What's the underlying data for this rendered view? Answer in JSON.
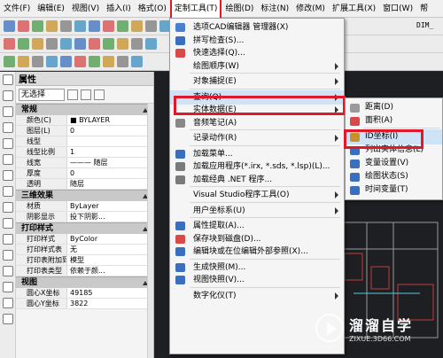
{
  "menubar": [
    "文件(F)",
    "编辑(E)",
    "视图(V)",
    "插入(I)",
    "格式(O)",
    "定制工具(T)",
    "绘图(D)",
    "标注(N)",
    "修改(M)",
    "扩展工具(X)",
    "窗口(W)",
    "帮"
  ],
  "toolbar_right_text": "DIM_",
  "panel": {
    "title": "属性",
    "selection": "无选择",
    "groups": [
      {
        "name": "常规",
        "rows": [
          {
            "k": "颜色(C)",
            "v": "■ BYLAYER"
          },
          {
            "k": "图层(L)",
            "v": "0"
          },
          {
            "k": "线型",
            "v": ""
          },
          {
            "k": "线型比例",
            "v": "1"
          },
          {
            "k": "线宽",
            "v": "——— 随层"
          },
          {
            "k": "厚度",
            "v": "0"
          },
          {
            "k": "透明",
            "v": "随层"
          }
        ]
      },
      {
        "name": "三维效果",
        "rows": [
          {
            "k": "材质",
            "v": "ByLayer"
          },
          {
            "k": "阴影显示",
            "v": "投下阴影..."
          }
        ]
      },
      {
        "name": "打印样式",
        "rows": [
          {
            "k": "打印样式",
            "v": "ByColor"
          },
          {
            "k": "打印样式表",
            "v": "无"
          },
          {
            "k": "打印表附加到",
            "v": "模型"
          },
          {
            "k": "打印表类型",
            "v": "依赖于颜..."
          }
        ]
      },
      {
        "name": "视图",
        "rows": [
          {
            "k": "圆心X坐标",
            "v": "49185"
          },
          {
            "k": "圆心Y坐标",
            "v": "3822"
          }
        ]
      }
    ]
  },
  "menu": [
    {
      "label": "选项CAD编辑器 管理器(X)",
      "icon": "#4a7fcf"
    },
    {
      "label": "拼写检查(S)...",
      "icon": "#3a6fbf"
    },
    {
      "label": "快速选择(Q)...",
      "icon": "#d84a4a"
    },
    {
      "label": "绘图顺序(W)",
      "arrow": true
    },
    {
      "sep": true
    },
    {
      "label": "对象捕捉(E)",
      "arrow": true
    },
    {
      "sep": true
    },
    {
      "label": "查询(Q)",
      "arrow": true,
      "hl": true
    },
    {
      "label": "实体数据(E)",
      "arrow": true
    },
    {
      "label": "音频笔记(A)",
      "icon": "#888888"
    },
    {
      "sep": true
    },
    {
      "label": "记录动作(R)",
      "arrow": true
    },
    {
      "sep": true
    },
    {
      "label": "加载菜单...",
      "icon": "#3a6fbf"
    },
    {
      "label": "加载应用程序(*.irx, *.sds, *.lsp)(L)...",
      "icon": "#7a7a7a"
    },
    {
      "label": "加载经典 .NET 程序...",
      "icon": "#7a7a7a"
    },
    {
      "sep": true
    },
    {
      "label": "Visual Studio程序工具(O)",
      "arrow": true
    },
    {
      "sep": true
    },
    {
      "label": "用户坐标系(U)",
      "arrow": true
    },
    {
      "sep": true
    },
    {
      "label": "属性提取(A)...",
      "icon": "#3a6fbf"
    },
    {
      "label": "保存块到磁盘(D)...",
      "icon": "#d84a4a"
    },
    {
      "label": "编辑块或在位编辑外部参照(X)...",
      "icon": "#3a6fbf"
    },
    {
      "sep": true
    },
    {
      "label": "生成快照(M)...",
      "icon": "#3a6fbf"
    },
    {
      "label": "视图快照(V)...",
      "icon": "#3a6fbf"
    },
    {
      "sep": true
    },
    {
      "label": "数字化仪(T)",
      "arrow": true
    }
  ],
  "submenu": [
    {
      "label": "距离(D)",
      "icon": "#9a9a9a"
    },
    {
      "label": "面积(A)",
      "icon": "#d84a4a"
    },
    {
      "sep": true
    },
    {
      "label": "ID坐标(I)",
      "icon": "#c8902a",
      "hl": true
    },
    {
      "label": "列出实体信息(L)",
      "icon": "#3a6fbf"
    },
    {
      "label": "变量设置(V)",
      "icon": "#3a6fbf"
    },
    {
      "label": "绘图状态(S)",
      "icon": "#3a6fbf"
    },
    {
      "label": "时间变量(T)",
      "icon": "#3a6fbf"
    }
  ],
  "watermark": {
    "title": "溜溜自学",
    "url": "ZIXUE.3D66.COM"
  }
}
